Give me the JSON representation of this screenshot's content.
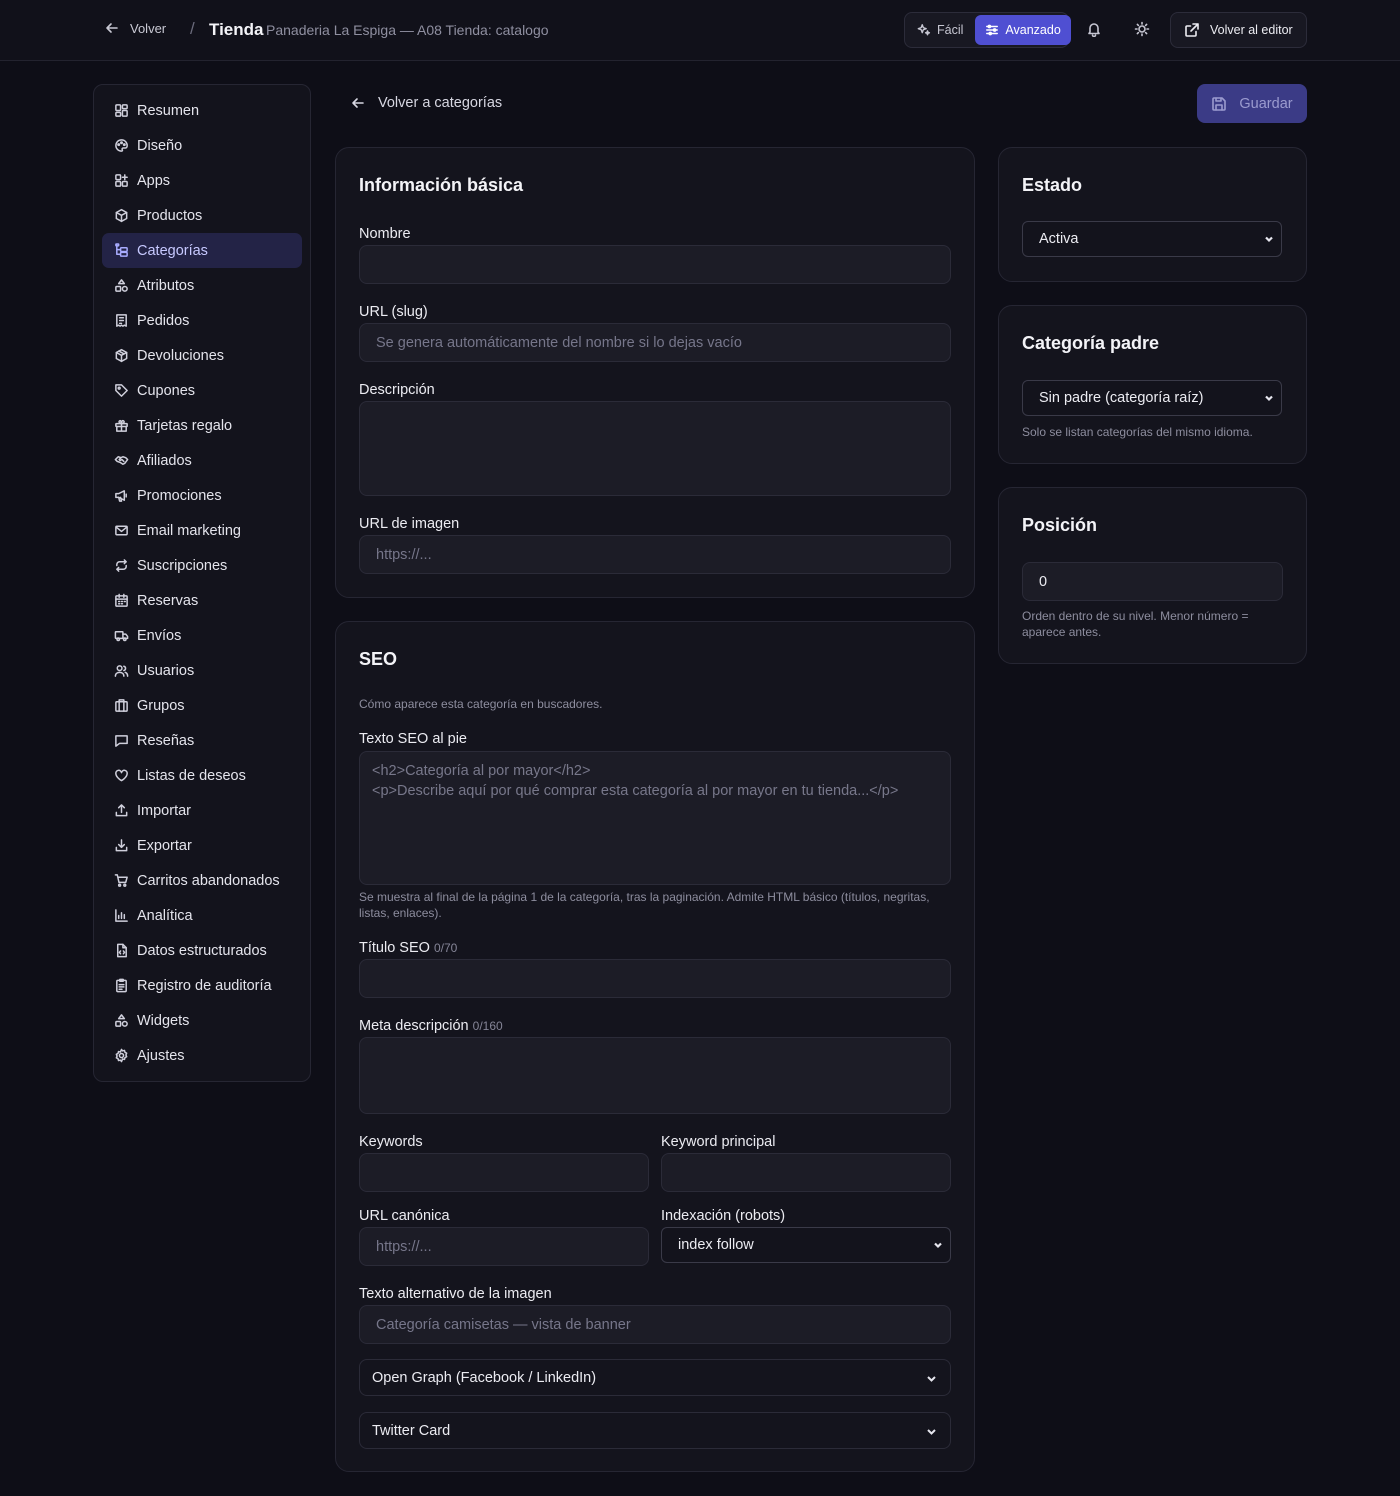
{
  "header": {
    "back_label": "Volver",
    "separator": "/",
    "title": "Tienda",
    "subtitle": "Panaderia La Espiga — A08 Tienda: catalogo",
    "mode_easy": "Fácil",
    "mode_advanced": "Avanzado",
    "editor_button": "Volver al editor"
  },
  "sidebar": {
    "items": [
      {
        "label": "Resumen",
        "icon": "dashboard-icon"
      },
      {
        "label": "Diseño",
        "icon": "palette-icon"
      },
      {
        "label": "Apps",
        "icon": "apps-icon"
      },
      {
        "label": "Productos",
        "icon": "box-icon"
      },
      {
        "label": "Categorías",
        "icon": "tree-icon",
        "active": true
      },
      {
        "label": "Atributos",
        "icon": "shapes-icon"
      },
      {
        "label": "Pedidos",
        "icon": "receipt-icon"
      },
      {
        "label": "Devoluciones",
        "icon": "package-return-icon"
      },
      {
        "label": "Cupones",
        "icon": "tag-icon"
      },
      {
        "label": "Tarjetas regalo",
        "icon": "gift-icon"
      },
      {
        "label": "Afiliados",
        "icon": "handshake-icon"
      },
      {
        "label": "Promociones",
        "icon": "megaphone-icon"
      },
      {
        "label": "Email marketing",
        "icon": "mail-icon"
      },
      {
        "label": "Suscripciones",
        "icon": "repeat-icon"
      },
      {
        "label": "Reservas",
        "icon": "calendar-icon"
      },
      {
        "label": "Envíos",
        "icon": "truck-icon"
      },
      {
        "label": "Usuarios",
        "icon": "users-icon"
      },
      {
        "label": "Grupos",
        "icon": "building-icon"
      },
      {
        "label": "Reseñas",
        "icon": "message-icon"
      },
      {
        "label": "Listas de deseos",
        "icon": "heart-icon"
      },
      {
        "label": "Importar",
        "icon": "upload-icon"
      },
      {
        "label": "Exportar",
        "icon": "download-icon"
      },
      {
        "label": "Carritos abandonados",
        "icon": "cart-icon"
      },
      {
        "label": "Analítica",
        "icon": "chart-icon"
      },
      {
        "label": "Datos estructurados",
        "icon": "file-code-icon"
      },
      {
        "label": "Registro de auditoría",
        "icon": "clipboard-icon"
      },
      {
        "label": "Widgets",
        "icon": "widgets-icon"
      },
      {
        "label": "Ajustes",
        "icon": "gear-icon"
      }
    ]
  },
  "main": {
    "back_to_categories": "Volver a categorías",
    "save_label": "Guardar",
    "basic": {
      "title": "Información básica",
      "name_label": "Nombre",
      "name_value": "",
      "slug_label": "URL (slug)",
      "slug_placeholder": "Se genera automáticamente del nombre si lo dejas vacío",
      "description_label": "Descripción",
      "description_value": "",
      "image_label": "URL de imagen",
      "image_placeholder": "https://..."
    },
    "seo": {
      "title": "SEO",
      "intro": "Cómo aparece esta categoría en buscadores.",
      "footer_text_label": "Texto SEO al pie",
      "footer_text_placeholder_line1": "<h2>Categoría al por mayor</h2>",
      "footer_text_placeholder_line2": "<p>Describe aquí por qué comprar esta categoría al por mayor en tu tienda...</p>",
      "footer_text_help": "Se muestra al final de la página 1 de la categoría, tras la paginación. Admite HTML básico (títulos, negritas, listas, enlaces).",
      "seo_title_label": "Título SEO",
      "seo_title_count": "0/70",
      "meta_label": "Meta descripción",
      "meta_count": "0/160",
      "keywords_label": "Keywords",
      "main_keyword_label": "Keyword principal",
      "canonical_label": "URL canónica",
      "canonical_placeholder": "https://...",
      "robots_label": "Indexación (robots)",
      "robots_value": "index follow",
      "alt_label": "Texto alternativo de la imagen",
      "alt_placeholder": "Categoría camisetas — vista de banner",
      "og_label": "Open Graph (Facebook / LinkedIn)",
      "twitter_label": "Twitter Card"
    },
    "status": {
      "title": "Estado",
      "value": "Activa"
    },
    "parent": {
      "title": "Categoría padre",
      "value": "Sin padre (categoría raíz)",
      "help": "Solo se listan categorías del mismo idioma."
    },
    "position": {
      "title": "Posición",
      "value": "0",
      "help_line1": "Orden dentro de su nivel. Menor número =",
      "help_line2": "aparece antes."
    }
  },
  "colors": {
    "background": "#0e0e17",
    "card": "#14141d",
    "accent": "#4f4fd2",
    "active_nav": "#232346"
  }
}
